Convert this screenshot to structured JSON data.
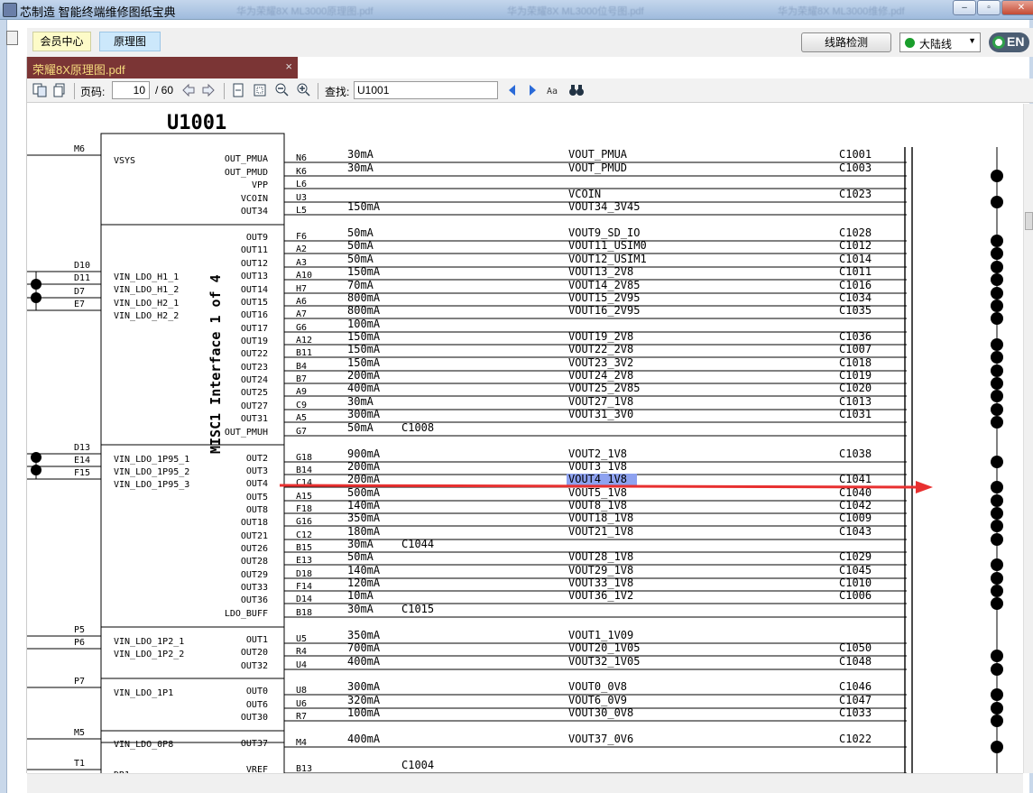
{
  "window": {
    "title": "芯制造 智能终端维修图纸宝典",
    "ghost_tabs": [
      "华为荣耀8X ML3000原理图.pdf",
      "华为荣耀8X ML3000位号图.pdf",
      "华为荣耀8X ML3000维修.pdf"
    ]
  },
  "topbar": {
    "vip_label": "会员中心",
    "schematic_label": "原理图",
    "check_label": "线路检测",
    "region_label": "大陆线",
    "lang_label": "EN"
  },
  "file_tab": {
    "name": "荣耀8X原理图.pdf",
    "close": "×"
  },
  "toolbar": {
    "page_label": "页码:",
    "page_current": "10",
    "page_total": "/ 60",
    "find_label": "查找:",
    "find_value": "U1001"
  },
  "schematic": {
    "ref": "U1001",
    "side_label": "MISC1 Interface 1 of 4",
    "left_pins": [
      {
        "pin": "M6",
        "net": "VSYS"
      },
      {
        "pin": "D10",
        "net": "VIN_LDO_H1_1"
      },
      {
        "pin": "D11",
        "net": "VIN_LDO_H1_2"
      },
      {
        "pin": "D7",
        "net": "VIN_LDO_H2_1"
      },
      {
        "pin": "E7",
        "net": "VIN_LDO_H2_2"
      },
      {
        "pin": "D13",
        "net": "VIN_LDO_1P95_1"
      },
      {
        "pin": "E14",
        "net": "VIN_LDO_1P95_2"
      },
      {
        "pin": "F15",
        "net": "VIN_LDO_1P95_3"
      },
      {
        "pin": "P5",
        "net": "VIN_LDO_1P2_1"
      },
      {
        "pin": "P6",
        "net": "VIN_LDO_1P2_2"
      },
      {
        "pin": "P7",
        "net": "VIN_LDO_1P1"
      },
      {
        "pin": "M5",
        "net": "VIN_LDO_0P8"
      },
      {
        "pin": "T1",
        "net": "DR1"
      }
    ],
    "rows": [
      {
        "out": "OUT_PMUA",
        "pin": "N6",
        "cur": "30mA",
        "net": "VOUT_PMUA",
        "cap": "C1001",
        "dot": false
      },
      {
        "out": "OUT_PMUD",
        "pin": "K6",
        "cur": "30mA",
        "net": "VOUT_PMUD",
        "cap": "C1003",
        "dot": true
      },
      {
        "out": "VPP",
        "pin": "L6",
        "cur": "",
        "net": "",
        "cap": "",
        "dot": false
      },
      {
        "out": "VCOIN",
        "pin": "U3",
        "cur": "",
        "net": "VCOIN",
        "cap": "C1023",
        "dot": true
      },
      {
        "out": "OUT34",
        "pin": "L5",
        "cur": "150mA",
        "net": "VOUT34_3V45",
        "cap": "",
        "dot": false
      },
      {
        "out": "OUT9",
        "pin": "F6",
        "cur": "50mA",
        "net": "VOUT9_SD_IO",
        "cap": "C1028",
        "dot": true
      },
      {
        "out": "OUT11",
        "pin": "A2",
        "cur": "50mA",
        "net": "VOUT11_USIM0",
        "cap": "C1012",
        "dot": true
      },
      {
        "out": "OUT12",
        "pin": "A3",
        "cur": "50mA",
        "net": "VOUT12_USIM1",
        "cap": "C1014",
        "dot": true
      },
      {
        "out": "OUT13",
        "pin": "A10",
        "cur": "150mA",
        "net": "VOUT13_2V8",
        "cap": "C1011",
        "dot": true
      },
      {
        "out": "OUT14",
        "pin": "H7",
        "cur": "70mA",
        "net": "VOUT14_2V85",
        "cap": "C1016",
        "dot": true
      },
      {
        "out": "OUT15",
        "pin": "A6",
        "cur": "800mA",
        "net": "VOUT15_2V95",
        "cap": "C1034",
        "dot": true
      },
      {
        "out": "OUT16",
        "pin": "A7",
        "cur": "800mA",
        "net": "VOUT16_2V95",
        "cap": "C1035",
        "dot": true
      },
      {
        "out": "OUT17",
        "pin": "G6",
        "cur": "100mA",
        "net": "",
        "cap": "",
        "dot": false
      },
      {
        "out": "OUT19",
        "pin": "A12",
        "cur": "150mA",
        "net": "VOUT19_2V8",
        "cap": "C1036",
        "dot": true
      },
      {
        "out": "OUT22",
        "pin": "B11",
        "cur": "150mA",
        "net": "VOUT22_2V8",
        "cap": "C1007",
        "dot": true
      },
      {
        "out": "OUT23",
        "pin": "B4",
        "cur": "150mA",
        "net": "VOUT23_3V2",
        "cap": "C1018",
        "dot": true
      },
      {
        "out": "OUT24",
        "pin": "B7",
        "cur": "200mA",
        "net": "VOUT24_2V8",
        "cap": "C1019",
        "dot": true
      },
      {
        "out": "OUT25",
        "pin": "A9",
        "cur": "400mA",
        "net": "VOUT25_2V85",
        "cap": "C1020",
        "dot": true
      },
      {
        "out": "OUT27",
        "pin": "C9",
        "cur": "30mA",
        "net": "VOUT27_1V8",
        "cap": "C1013",
        "dot": true
      },
      {
        "out": "OUT31",
        "pin": "A5",
        "cur": "300mA",
        "net": "VOUT31_3V0",
        "cap": "C1031",
        "dot": true
      },
      {
        "out": "OUT_PMUH",
        "pin": "G7",
        "cur": "50mA",
        "net": "",
        "cap": "C1008",
        "dot": false
      },
      {
        "out": "OUT2",
        "pin": "G18",
        "cur": "900mA",
        "net": "VOUT2_1V8",
        "cap": "C1038",
        "dot": true
      },
      {
        "out": "OUT3",
        "pin": "B14",
        "cur": "200mA",
        "net": "VOUT3_1V8",
        "cap": "",
        "dot": false
      },
      {
        "out": "OUT4",
        "pin": "C14",
        "cur": "200mA",
        "net": "VOUT4_1V8",
        "cap": "C1041",
        "dot": true
      },
      {
        "out": "OUT5",
        "pin": "A15",
        "cur": "500mA",
        "net": "VOUT5_1V8",
        "cap": "C1040",
        "dot": true
      },
      {
        "out": "OUT8",
        "pin": "F18",
        "cur": "140mA",
        "net": "VOUT8_1V8",
        "cap": "C1042",
        "dot": true
      },
      {
        "out": "OUT18",
        "pin": "G16",
        "cur": "350mA",
        "net": "VOUT18_1V8",
        "cap": "C1009",
        "dot": true
      },
      {
        "out": "OUT21",
        "pin": "C12",
        "cur": "180mA",
        "net": "VOUT21_1V8",
        "cap": "C1043",
        "dot": true
      },
      {
        "out": "OUT26",
        "pin": "B15",
        "cur": "30mA",
        "net": "",
        "cap": "C1044",
        "dot": false
      },
      {
        "out": "OUT28",
        "pin": "E13",
        "cur": "50mA",
        "net": "VOUT28_1V8",
        "cap": "C1029",
        "dot": true
      },
      {
        "out": "OUT29",
        "pin": "D18",
        "cur": "140mA",
        "net": "VOUT29_1V8",
        "cap": "C1045",
        "dot": true
      },
      {
        "out": "OUT33",
        "pin": "F14",
        "cur": "120mA",
        "net": "VOUT33_1V8",
        "cap": "C1010",
        "dot": true
      },
      {
        "out": "OUT36",
        "pin": "D14",
        "cur": "10mA",
        "net": "VOUT36_1V2",
        "cap": "C1006",
        "dot": true
      },
      {
        "out": "LDO_BUFF",
        "pin": "B18",
        "cur": "30mA",
        "net": "",
        "cap": "C1015",
        "dot": false
      },
      {
        "out": "OUT1",
        "pin": "U5",
        "cur": "350mA",
        "net": "VOUT1_1V09",
        "cap": "",
        "dot": false
      },
      {
        "out": "OUT20",
        "pin": "R4",
        "cur": "700mA",
        "net": "VOUT20_1V05",
        "cap": "C1050",
        "dot": true
      },
      {
        "out": "OUT32",
        "pin": "U4",
        "cur": "400mA",
        "net": "VOUT32_1V05",
        "cap": "C1048",
        "dot": true
      },
      {
        "out": "OUT0",
        "pin": "U8",
        "cur": "300mA",
        "net": "VOUT0_0V8",
        "cap": "C1046",
        "dot": true
      },
      {
        "out": "OUT6",
        "pin": "U6",
        "cur": "320mA",
        "net": "VOUT6_0V9",
        "cap": "C1047",
        "dot": true
      },
      {
        "out": "OUT30",
        "pin": "R7",
        "cur": "100mA",
        "net": "VOUT30_0V8",
        "cap": "C1033",
        "dot": true
      },
      {
        "out": "OUT37",
        "pin": "M4",
        "cur": "400mA",
        "net": "VOUT37_0V6",
        "cap": "C1022",
        "dot": true
      },
      {
        "out": "VREF",
        "pin": "B13",
        "cur": "",
        "net": "",
        "cap": "C1004",
        "dot": false
      }
    ],
    "highlight_net": "VOUT4_1V8"
  },
  "colors": {
    "highlight": "#8ea2f0",
    "arrow": "#e83030",
    "tab_bg": "#7b3535",
    "tab_text": "#f4d97c"
  }
}
